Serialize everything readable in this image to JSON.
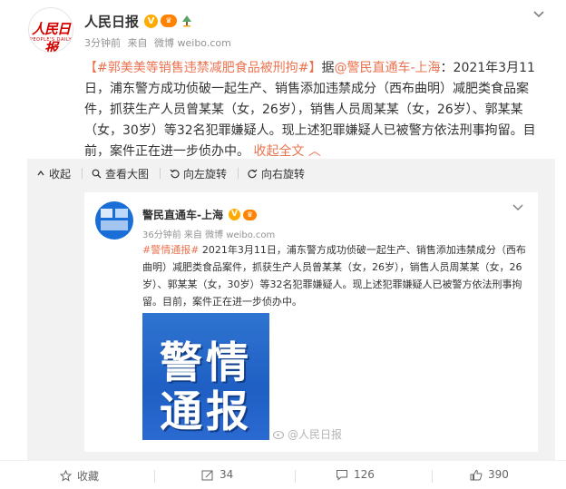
{
  "post": {
    "author": "人民日报",
    "avatar_logo_text": "人民日报",
    "avatar_logo_sub": "PEOPLE'S DAILY",
    "verified_badge": "V",
    "vip_badge": "会员",
    "meta": {
      "time": "3分钟前",
      "source_prefix": "来自",
      "source": "微博 weibo.com"
    },
    "text": {
      "tag": "【#郭美美等销售违禁减肥食品被刑拘#】",
      "pre_mention": "据",
      "mention": "@警民直通车-上海",
      "body": "：2021年3月11日，浦东警方成功侦破一起生产、销售添加违禁成分（西布曲明）减肥类食品案件，抓获生产人员曾某某（女，26岁），销售人员周某某（女，26岁）、郭某某（女，30岁）等32名犯罪嫌疑人。现上述犯罪嫌疑人已被警方依法刑事拘留。目前，案件正在进一步侦办中。",
      "collapse": "收起全文"
    }
  },
  "toolbar": {
    "collapse": "收起",
    "view_large": "查看大图",
    "rotate_left": "向左旋转",
    "rotate_right": "向右旋转"
  },
  "repost": {
    "author": "警民直通车-上海",
    "verified_badge": "V",
    "meta": {
      "time": "36分钟前",
      "source_prefix": "来自",
      "source": "微博 weibo.com"
    },
    "tag": "#警情通报#",
    "body": " 2021年3月11日，浦东警方成功侦破一起生产、销售添加违禁成分（西布曲明）减肥类食品案件，抓获生产人员曾某某（女，26岁），销售人员周某某（女，26岁）、郭某某（女，30岁）等32名犯罪嫌疑人。现上述犯罪嫌疑人已被警方依法刑事拘留。目前，案件正在进一步侦办中。",
    "image": {
      "line1": "警情",
      "line2": "通报"
    },
    "watermark": "@人民日报"
  },
  "footer": {
    "favorite": "收藏",
    "repost_count": "34",
    "comment_count": "126",
    "like_count": "390"
  },
  "colors": {
    "link": "#eb7350",
    "meta": "#939393",
    "image_blue": "#2f74d0"
  },
  "icons": [
    "chevron-down-icon",
    "collapse-icon",
    "search-icon",
    "rotate-left-icon",
    "rotate-right-icon",
    "star-icon",
    "repost-icon",
    "comment-icon",
    "like-icon"
  ]
}
